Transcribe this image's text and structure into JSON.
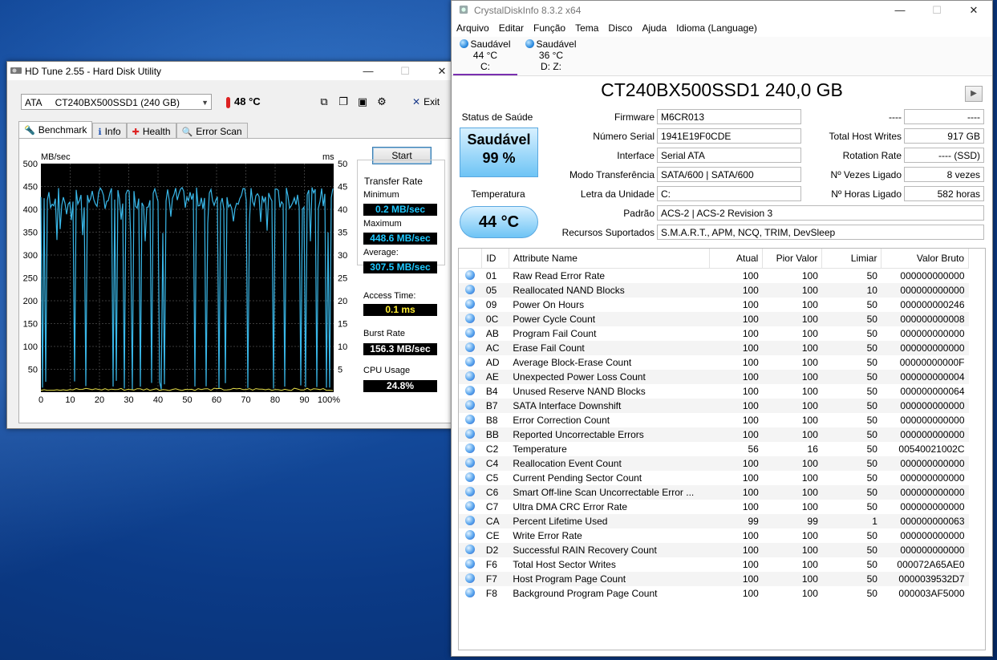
{
  "hdtune": {
    "title": "HD Tune 2.55 - Hard Disk Utility",
    "drive_select": "ATA     CT240BX500SSD1 (240 GB)",
    "temperature": "48 °C",
    "exit_label": "Exit",
    "tabs": [
      "Benchmark",
      "Info",
      "Health",
      "Error Scan"
    ],
    "start_label": "Start",
    "graph": {
      "left_unit": "MB/sec",
      "right_unit": "ms",
      "left_ticks": [
        "500",
        "450",
        "400",
        "350",
        "300",
        "250",
        "200",
        "150",
        "100",
        "50"
      ],
      "right_ticks": [
        "50",
        "45",
        "40",
        "35",
        "30",
        "25",
        "20",
        "15",
        "10",
        "5"
      ],
      "x_ticks": [
        "0",
        "10",
        "20",
        "30",
        "40",
        "50",
        "60",
        "70",
        "80",
        "90",
        "100%"
      ]
    },
    "transfer_rate": {
      "label": "Transfer Rate",
      "minimum_label": "Minimum",
      "minimum": "0.2 MB/sec",
      "maximum_label": "Maximum",
      "maximum": "448.6 MB/sec",
      "average_label": "Average:",
      "average": "307.5 MB/sec"
    },
    "access_time_label": "Access Time:",
    "access_time": "0.1 ms",
    "burst_rate_label": "Burst Rate",
    "burst_rate": "156.3 MB/sec",
    "cpu_usage_label": "CPU Usage",
    "cpu_usage": "24.8%"
  },
  "cdi": {
    "title": "CrystalDiskInfo 8.3.2 x64",
    "menu": [
      "Arquivo",
      "Editar",
      "Função",
      "Tema",
      "Disco",
      "Ajuda",
      "Idioma (Language)"
    ],
    "drives": [
      {
        "status": "Saudável",
        "temp": "44 °C",
        "letter": "C:"
      },
      {
        "status": "Saudável",
        "temp": "36 °C",
        "letter": "D: Z:"
      }
    ],
    "model": "CT240BX500SSD1 240,0 GB",
    "status_label": "Status de Saúde",
    "health": "Saudável",
    "health_pct": "99 %",
    "temp_label": "Temperatura",
    "temp": "44 °C",
    "fields": {
      "firmware_label": "Firmware",
      "firmware": "M6CR013",
      "serial_label": "Número Serial",
      "serial": "1941E19F0CDE",
      "interface_label": "Interface",
      "interface": "Serial ATA",
      "transfer_label": "Modo Transferência",
      "transfer": "SATA/600 | SATA/600",
      "letter_label": "Letra da Unidade",
      "letter": "C:",
      "standard_label": "Padrão",
      "standard": "ACS-2 | ACS-2 Revision 3",
      "features_label": "Recursos Suportados",
      "features": "S.M.A.R.T., APM, NCQ, TRIM, DevSleep",
      "blank_label": "----",
      "blank": "----",
      "writes_label": "Total Host Writes",
      "writes": "917 GB",
      "rotation_label": "Rotation Rate",
      "rotation": "---- (SSD)",
      "poweron_count_label": "Nº Vezes Ligado",
      "poweron_count": "8 vezes",
      "poweron_hours_label": "Nº Horas Ligado",
      "poweron_hours": "582 horas"
    },
    "smart_headers": [
      "ID",
      "Attribute Name",
      "Atual",
      "Pior Valor",
      "Limiar",
      "Valor Bruto"
    ],
    "smart_rows": [
      [
        "01",
        "Raw Read Error Rate",
        "100",
        "100",
        "50",
        "000000000000"
      ],
      [
        "05",
        "Reallocated NAND Blocks",
        "100",
        "100",
        "10",
        "000000000000"
      ],
      [
        "09",
        "Power On Hours",
        "100",
        "100",
        "50",
        "000000000246"
      ],
      [
        "0C",
        "Power Cycle Count",
        "100",
        "100",
        "50",
        "000000000008"
      ],
      [
        "AB",
        "Program Fail Count",
        "100",
        "100",
        "50",
        "000000000000"
      ],
      [
        "AC",
        "Erase Fail Count",
        "100",
        "100",
        "50",
        "000000000000"
      ],
      [
        "AD",
        "Average Block-Erase Count",
        "100",
        "100",
        "50",
        "00000000000F"
      ],
      [
        "AE",
        "Unexpected Power Loss Count",
        "100",
        "100",
        "50",
        "000000000004"
      ],
      [
        "B4",
        "Unused Reserve NAND Blocks",
        "100",
        "100",
        "50",
        "000000000064"
      ],
      [
        "B7",
        "SATA Interface Downshift",
        "100",
        "100",
        "50",
        "000000000000"
      ],
      [
        "B8",
        "Error Correction Count",
        "100",
        "100",
        "50",
        "000000000000"
      ],
      [
        "BB",
        "Reported Uncorrectable Errors",
        "100",
        "100",
        "50",
        "000000000000"
      ],
      [
        "C2",
        "Temperature",
        "56",
        "16",
        "50",
        "00540021002C"
      ],
      [
        "C4",
        "Reallocation Event Count",
        "100",
        "100",
        "50",
        "000000000000"
      ],
      [
        "C5",
        "Current Pending Sector Count",
        "100",
        "100",
        "50",
        "000000000000"
      ],
      [
        "C6",
        "Smart Off-line Scan Uncorrectable Error ...",
        "100",
        "100",
        "50",
        "000000000000"
      ],
      [
        "C7",
        "Ultra DMA CRC Error Rate",
        "100",
        "100",
        "50",
        "000000000000"
      ],
      [
        "CA",
        "Percent Lifetime Used",
        "99",
        "99",
        "1",
        "000000000063"
      ],
      [
        "CE",
        "Write Error Rate",
        "100",
        "100",
        "50",
        "000000000000"
      ],
      [
        "D2",
        "Successful RAIN Recovery Count",
        "100",
        "100",
        "50",
        "000000000000"
      ],
      [
        "F6",
        "Total Host Sector Writes",
        "100",
        "100",
        "50",
        "000072A65AE0"
      ],
      [
        "F7",
        "Host Program Page Count",
        "100",
        "100",
        "50",
        "0000039532D7"
      ],
      [
        "F8",
        "Background Program Page Count",
        "100",
        "100",
        "50",
        "000003AF5000"
      ]
    ]
  }
}
